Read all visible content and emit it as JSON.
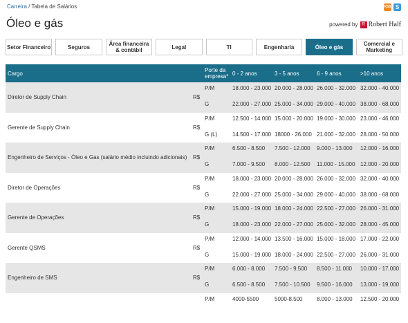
{
  "breadcrumb": {
    "link": "Carreira",
    "sep": " / ",
    "current": "Tabela de Salários"
  },
  "share": {
    "rss_icon": "RSS",
    "skype_icon": "S"
  },
  "title": "Óleo e gás",
  "powered": {
    "text": "powered by",
    "brand": "Robert Half",
    "brand_mark": "R"
  },
  "tabs": [
    {
      "label": "Setor Financeiro",
      "active": false
    },
    {
      "label": "Seguros",
      "active": false
    },
    {
      "label": "Área financeira & contábil",
      "active": false
    },
    {
      "label": "Legal",
      "active": false
    },
    {
      "label": "TI",
      "active": false
    },
    {
      "label": "Engenharia",
      "active": false
    },
    {
      "label": "Óleo e gás",
      "active": true
    },
    {
      "label": "Comercial e Marketing",
      "active": false
    }
  ],
  "table": {
    "headers": {
      "cargo": "Cargo",
      "porte": "Porte da empresa*",
      "c0": "0 - 2 anos",
      "c3": "3 - 5 anos",
      "c6": "6 - 9 anos",
      "c10": ">10 anos"
    },
    "rows": [
      {
        "cargo": "Diretor de Supply Chain",
        "currency": "R$",
        "a": [
          "P/M",
          "18.000 - 23.000",
          "20.000 - 28.000",
          "26.000 - 32.000",
          "32.000 - 40.000"
        ],
        "b": [
          "G",
          "22.000 - 27.000",
          "25.000 - 34.000",
          "29.000 - 40.000",
          "38.000 - 68.000"
        ]
      },
      {
        "cargo": "Gerente de Supply Chain",
        "currency": "R$",
        "a": [
          "P/M",
          "12.500 - 14.000",
          "15.000 - 20.000",
          "19.000 - 30.000",
          "23.000 - 46.000"
        ],
        "b": [
          "G (L)",
          "14.500 - 17.000",
          "18000 - 26.000",
          "21.000 - 32.000",
          "28.000 - 50.000"
        ]
      },
      {
        "cargo": "Engenheiro de Serviços - Óleo e Gas (salário médio incluindo adicionais)",
        "currency": "R$",
        "a": [
          "P/M",
          "6.500 - 8.500",
          "7.500 - 12.000",
          "9.000 - 13.000",
          "12.000 - 16.000"
        ],
        "b": [
          "G",
          "7.000 - 9.500",
          "8.000 - 12.500",
          "11.000 - 15.000",
          "12.000 - 20.000"
        ]
      },
      {
        "cargo": "Diretor de Operações",
        "currency": "R$",
        "a": [
          "P/M",
          "18.000 - 23.000",
          "20.000 - 28.000",
          "26.000 - 32.000",
          "32.000 - 40.000"
        ],
        "b": [
          "G",
          "22.000 - 27.000",
          "25.000 - 34.000",
          "29.000 - 40.000",
          "38.000 - 68.000"
        ]
      },
      {
        "cargo": "Gerente de Operações",
        "currency": "R$",
        "a": [
          "P/M",
          "15.000 - 19.000",
          "18.000 - 24.000",
          "22.500 - 27.000",
          "26.000 - 31.000"
        ],
        "b": [
          "G",
          "18.000 - 23.000",
          "22.000 - 27.000",
          "25.000 - 32.000",
          "28.000 - 45.000"
        ]
      },
      {
        "cargo": "Gerente QSMS",
        "currency": "R$",
        "a": [
          "P/M",
          "12.000 - 14.000",
          "13.500 - 16.000",
          "15.000 - 18.000",
          "17.000 - 22.000"
        ],
        "b": [
          "G",
          "15.000 - 19.000",
          "18.000 - 24.000",
          "22.500 - 27.000",
          "26.000 - 31.000"
        ]
      },
      {
        "cargo": "Engenheiro de SMS",
        "currency": "R$",
        "a": [
          "P/M",
          "6.000 - 8.000",
          "7.500 - 9.500",
          "8.500 - 11.000",
          "10.000 - 17.000"
        ],
        "b": [
          "G",
          "6.500 - 8.500",
          "7.500 - 10.500",
          "9.500 - 16.000",
          "13.000 - 19.000"
        ]
      },
      {
        "cargo": "",
        "currency": "",
        "a": [
          "P/M",
          "4000-5500",
          "5000-8.500",
          "8.000 - 13.000",
          "12.500 - 20.000"
        ],
        "b": [
          "",
          "",
          "",
          "",
          ""
        ]
      }
    ]
  }
}
